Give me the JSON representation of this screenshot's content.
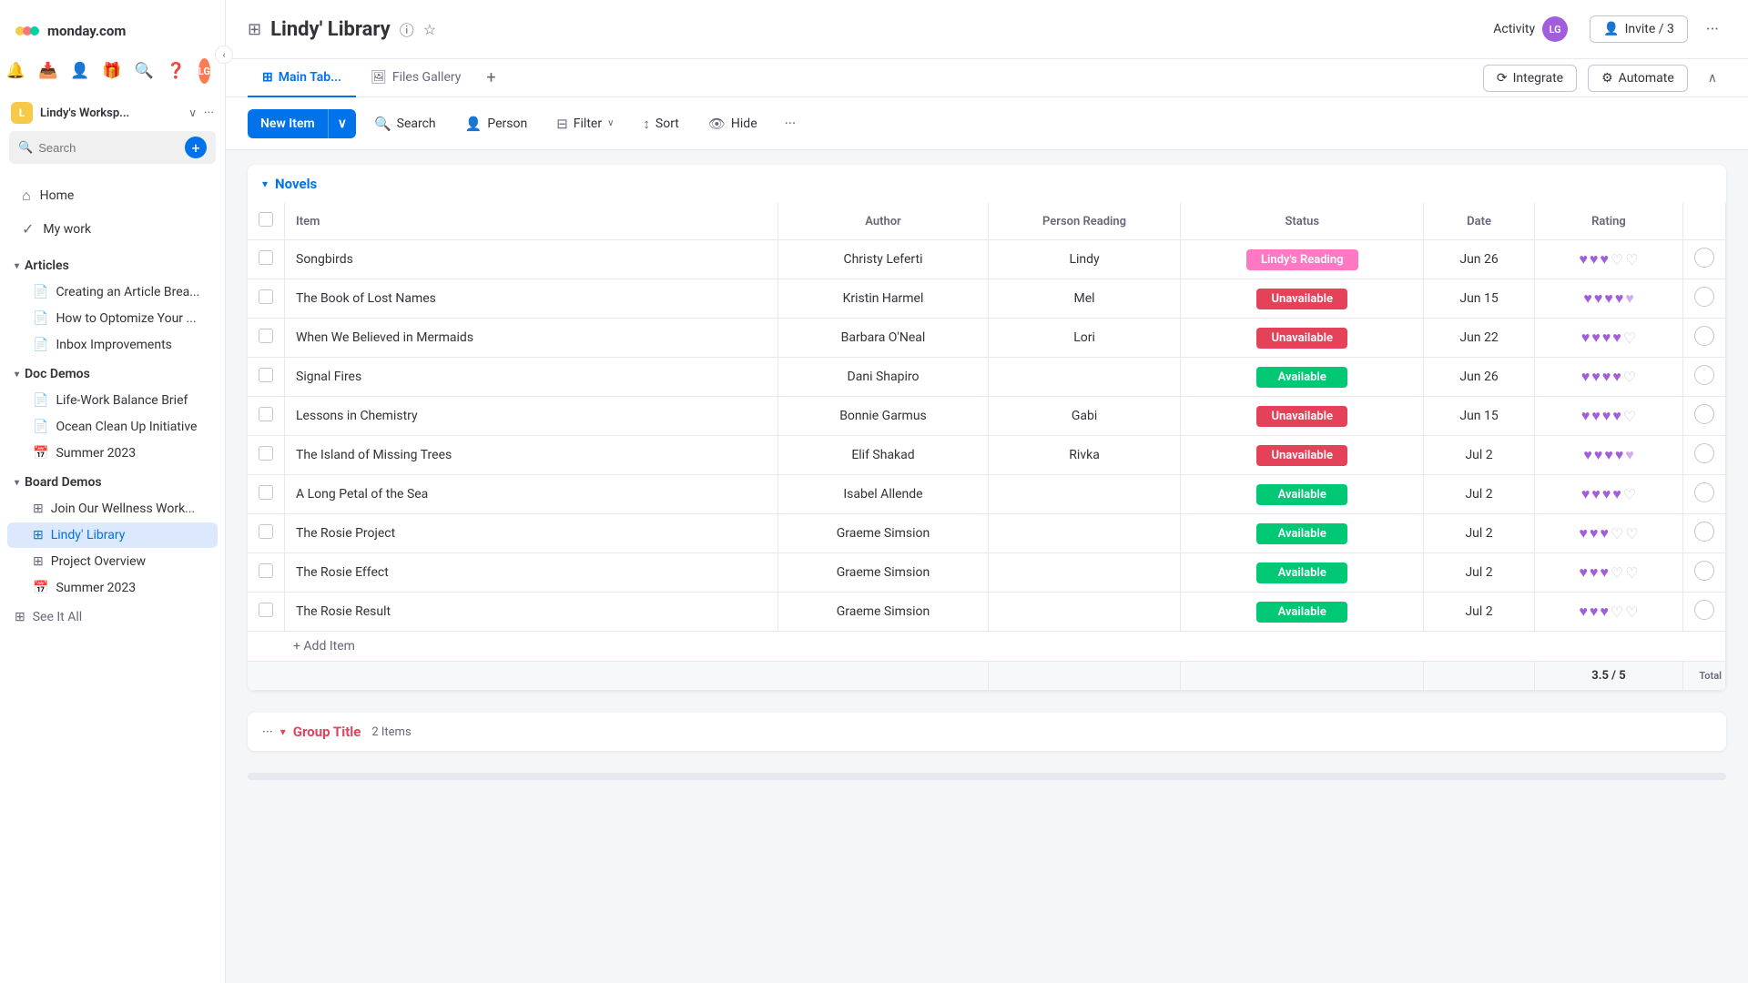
{
  "app": {
    "name": "monday.com"
  },
  "topbar_global": {
    "bell_icon": "🔔",
    "inbox_icon": "📥",
    "people_icon": "👤",
    "gift_icon": "🎁",
    "search_icon": "🔍",
    "help_icon": "❓"
  },
  "sidebar": {
    "collapse_icon": "‹",
    "logo_text": "monday.com",
    "nav": [
      {
        "id": "home",
        "icon": "⌂",
        "label": "Home"
      },
      {
        "id": "my-work",
        "icon": "✓",
        "label": "My work"
      }
    ],
    "workspace": {
      "badge": "L",
      "name": "Lindy's Worksp...",
      "chevron": "∨",
      "more_icon": "···"
    },
    "search": {
      "placeholder": "Search",
      "icon": "🔍"
    },
    "add_button": "+",
    "sections": [
      {
        "id": "articles",
        "label": "Articles",
        "chevron": "▾",
        "items": [
          {
            "id": "article-1",
            "icon": "📄",
            "label": "Creating an Article Brea..."
          },
          {
            "id": "article-2",
            "icon": "📄",
            "label": "How to Optomize Your ..."
          },
          {
            "id": "article-3",
            "icon": "📄",
            "label": "Inbox Improvements"
          }
        ]
      },
      {
        "id": "doc-demos",
        "label": "Doc Demos",
        "chevron": "▾",
        "items": [
          {
            "id": "doc-1",
            "icon": "📄",
            "label": "Life-Work Balance Brief"
          },
          {
            "id": "doc-2",
            "icon": "📄",
            "label": "Ocean Clean Up Initiative"
          },
          {
            "id": "doc-3",
            "icon": "📅",
            "label": "Summer 2023"
          }
        ]
      },
      {
        "id": "board-demos",
        "label": "Board Demos",
        "chevron": "▾",
        "items": [
          {
            "id": "board-1",
            "icon": "⊞",
            "label": "Join Our Wellness Work..."
          },
          {
            "id": "board-2",
            "icon": "⊞",
            "label": "Lindy' Library",
            "active": true
          },
          {
            "id": "board-3",
            "icon": "⊞",
            "label": "Project Overview"
          },
          {
            "id": "board-4",
            "icon": "📅",
            "label": "Summer 2023"
          }
        ]
      }
    ],
    "see_all": "See It All"
  },
  "header": {
    "board_icon": "⊞",
    "title": "Lindy' Library",
    "info_icon": "ℹ",
    "star_icon": "☆"
  },
  "activity": {
    "label": "Activity",
    "avatar_initials": "LG"
  },
  "invite": {
    "label": "Invite / 3",
    "icon": "👤"
  },
  "more_icon": "···",
  "tabs": [
    {
      "id": "main-tab",
      "icon": "⊞",
      "label": "Main Tab...",
      "active": true
    },
    {
      "id": "files-gallery",
      "icon": "🖼",
      "label": "Files Gallery"
    },
    {
      "id": "add-tab",
      "icon": "+"
    }
  ],
  "tabs_right": {
    "integrate_icon": "⟳",
    "integrate_label": "Integrate",
    "automate_icon": "⚙",
    "automate_label": "Automate",
    "collapse_icon": "∧"
  },
  "toolbar": {
    "new_item_label": "New Item",
    "new_item_arrow": "∨",
    "search_icon": "🔍",
    "search_label": "Search",
    "person_icon": "👤",
    "person_label": "Person",
    "filter_icon": "⊟",
    "filter_label": "Filter",
    "sort_icon": "↕",
    "sort_label": "Sort",
    "hide_icon": "👁",
    "hide_label": "Hide",
    "more_icon": "···"
  },
  "novels_group": {
    "chevron": "▾",
    "title": "Novels",
    "columns": [
      {
        "id": "checkbox",
        "label": ""
      },
      {
        "id": "item",
        "label": "Item"
      },
      {
        "id": "author",
        "label": "Author"
      },
      {
        "id": "person-reading",
        "label": "Person Reading"
      },
      {
        "id": "status",
        "label": "Status"
      },
      {
        "id": "date",
        "label": "Date"
      },
      {
        "id": "rating",
        "label": "Rating"
      }
    ],
    "rows": [
      {
        "id": 1,
        "item": "Songbirds",
        "author": "Christy Leferti",
        "person_reading": "Lindy",
        "status": "Lindy's Reading",
        "status_class": "status-reading",
        "date": "Jun 26",
        "rating": 3
      },
      {
        "id": 2,
        "item": "The Book of Lost Names",
        "author": "Kristin Harmel",
        "person_reading": "Mel",
        "status": "Unavailable",
        "status_class": "status-unavailable",
        "date": "Jun 15",
        "rating": 4.5
      },
      {
        "id": 3,
        "item": "When We Believed in Mermaids",
        "author": "Barbara O'Neal",
        "person_reading": "Lori",
        "status": "Unavailable",
        "status_class": "status-unavailable",
        "date": "Jun 22",
        "rating": 4
      },
      {
        "id": 4,
        "item": "Signal Fires",
        "author": "Dani Shapiro",
        "person_reading": "",
        "status": "Available",
        "status_class": "status-available",
        "date": "Jun 26",
        "rating": 4
      },
      {
        "id": 5,
        "item": "Lessons in Chemistry",
        "author": "Bonnie Garmus",
        "person_reading": "Gabi",
        "status": "Unavailable",
        "status_class": "status-unavailable",
        "date": "Jun 15",
        "rating": 4
      },
      {
        "id": 6,
        "item": "The Island of Missing Trees",
        "author": "Elif Shakad",
        "person_reading": "Rivka",
        "status": "Unavailable",
        "status_class": "status-unavailable",
        "date": "Jul 2",
        "rating": 4.5
      },
      {
        "id": 7,
        "item": "A Long Petal of the Sea",
        "author": "Isabel Allende",
        "person_reading": "",
        "status": "Available",
        "status_class": "status-available",
        "date": "Jul 2",
        "rating": 4
      },
      {
        "id": 8,
        "item": "The Rosie Project",
        "author": "Graeme Simsion",
        "person_reading": "",
        "status": "Available",
        "status_class": "status-available",
        "date": "Jul 2",
        "rating": 3
      },
      {
        "id": 9,
        "item": "The Rosie Effect",
        "author": "Graeme Simsion",
        "person_reading": "",
        "status": "Available",
        "status_class": "status-available",
        "date": "Jul 2",
        "rating": 3
      },
      {
        "id": 10,
        "item": "The Rosie Result",
        "author": "Graeme Simsion",
        "person_reading": "",
        "status": "Available",
        "status_class": "status-available",
        "date": "Jul 2",
        "rating": 3
      }
    ],
    "add_item_label": "+ Add Item",
    "total_rating": "3.5 / 5",
    "total_label": "Total"
  },
  "group2": {
    "more_icon": "···",
    "chevron": "▾",
    "title": "Group Title",
    "count": "2 Items"
  }
}
